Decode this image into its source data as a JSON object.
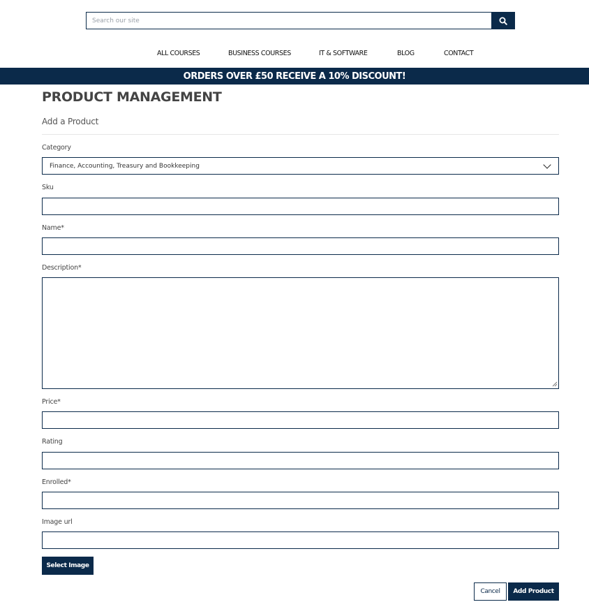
{
  "search": {
    "placeholder": "Search our site"
  },
  "nav": {
    "items": [
      "ALL COURSES",
      "BUSINESS COURSES",
      "IT & SOFTWARE",
      "BLOG",
      "CONTACT"
    ]
  },
  "banner": {
    "text": "ORDERS OVER £50 RECEIVE A 10% DISCOUNT!"
  },
  "page": {
    "title": "PRODUCT MANAGEMENT",
    "subtitle": "Add a Product"
  },
  "form": {
    "category": {
      "label": "Category",
      "value": "Finance, Accounting, Treasury and Bookkeeping"
    },
    "sku": {
      "label": "Sku",
      "value": ""
    },
    "name": {
      "label": "Name*",
      "value": ""
    },
    "description": {
      "label": "Description*",
      "value": ""
    },
    "price": {
      "label": "Price*",
      "value": ""
    },
    "rating": {
      "label": "Rating",
      "value": ""
    },
    "enrolled": {
      "label": "Enrolled*",
      "value": ""
    },
    "image_url": {
      "label": "Image url",
      "value": ""
    }
  },
  "buttons": {
    "select_image": "Select Image",
    "cancel": "Cancel",
    "add_product": "Add Product"
  },
  "colors": {
    "brand": "#0b2a4a"
  },
  "icons": {
    "search": "search-icon",
    "dropdown": "chevron-down-icon",
    "resize": "resize-grip-icon"
  }
}
